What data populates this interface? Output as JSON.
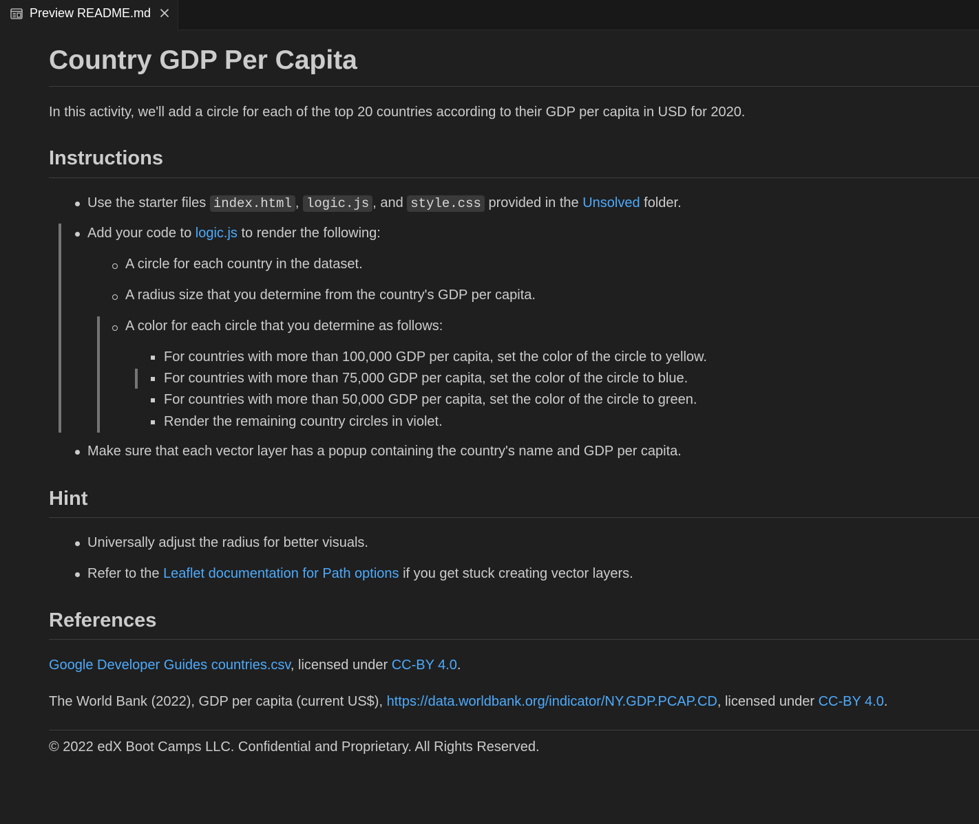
{
  "tab": {
    "label": "Preview README.md"
  },
  "doc": {
    "title": "Country GDP Per Capita",
    "intro": "In this activity, we'll add a circle for each of the top 20 countries according to their GDP per capita in USD for 2020.",
    "instructions": {
      "heading": "Instructions",
      "item1": {
        "pre": "Use the starter files ",
        "code1": "index.html",
        "sep1": ", ",
        "code2": "logic.js",
        "sep2": ", and ",
        "code3": "style.css",
        "mid": " provided in the ",
        "link": "Unsolved",
        "post": " folder."
      },
      "item2": {
        "pre": "Add your code to ",
        "link": "logic.js",
        "post": " to render the following:"
      },
      "sub1": "A circle for each country in the dataset.",
      "sub2": "A radius size that you determine from the country's GDP per capita.",
      "sub3": "A color for each circle that you determine as follows:",
      "color1": "For countries with more than 100,000 GDP per capita, set the color of the circle to yellow.",
      "color2": "For countries with more than 75,000 GDP per capita, set the color of the circle to blue.",
      "color3": "For countries with more than 50,000 GDP per capita, set the color of the circle to green.",
      "color4": "Render the remaining country circles in violet.",
      "item3": "Make sure that each vector layer has a popup containing the country's name and GDP per capita."
    },
    "hint": {
      "heading": "Hint",
      "item1": "Universally adjust the radius for better visuals.",
      "item2": {
        "pre": "Refer to the ",
        "link": "Leaflet documentation for Path options",
        "post": " if you get stuck creating vector layers."
      }
    },
    "references": {
      "heading": "References",
      "ref1": {
        "link": "Google Developer Guides countries.csv",
        "mid": ", licensed under ",
        "license": "CC-BY 4.0",
        "post": "."
      },
      "ref2": {
        "pre": "The World Bank (2022), GDP per capita (current US$), ",
        "link": "https://data.worldbank.org/indicator/NY.GDP.PCAP.CD",
        "mid": ", licensed under ",
        "license": "CC-BY 4.0",
        "post": "."
      }
    },
    "footer": "© 2022 edX Boot Camps LLC. Confidential and Proprietary. All Rights Reserved."
  },
  "colors": {
    "background": "#1f1f1f",
    "text": "#cccccc",
    "link": "#4daafc",
    "code_bg": "#3a3a3a"
  },
  "icons": {
    "tab": "preview-icon",
    "close": "close-icon"
  }
}
